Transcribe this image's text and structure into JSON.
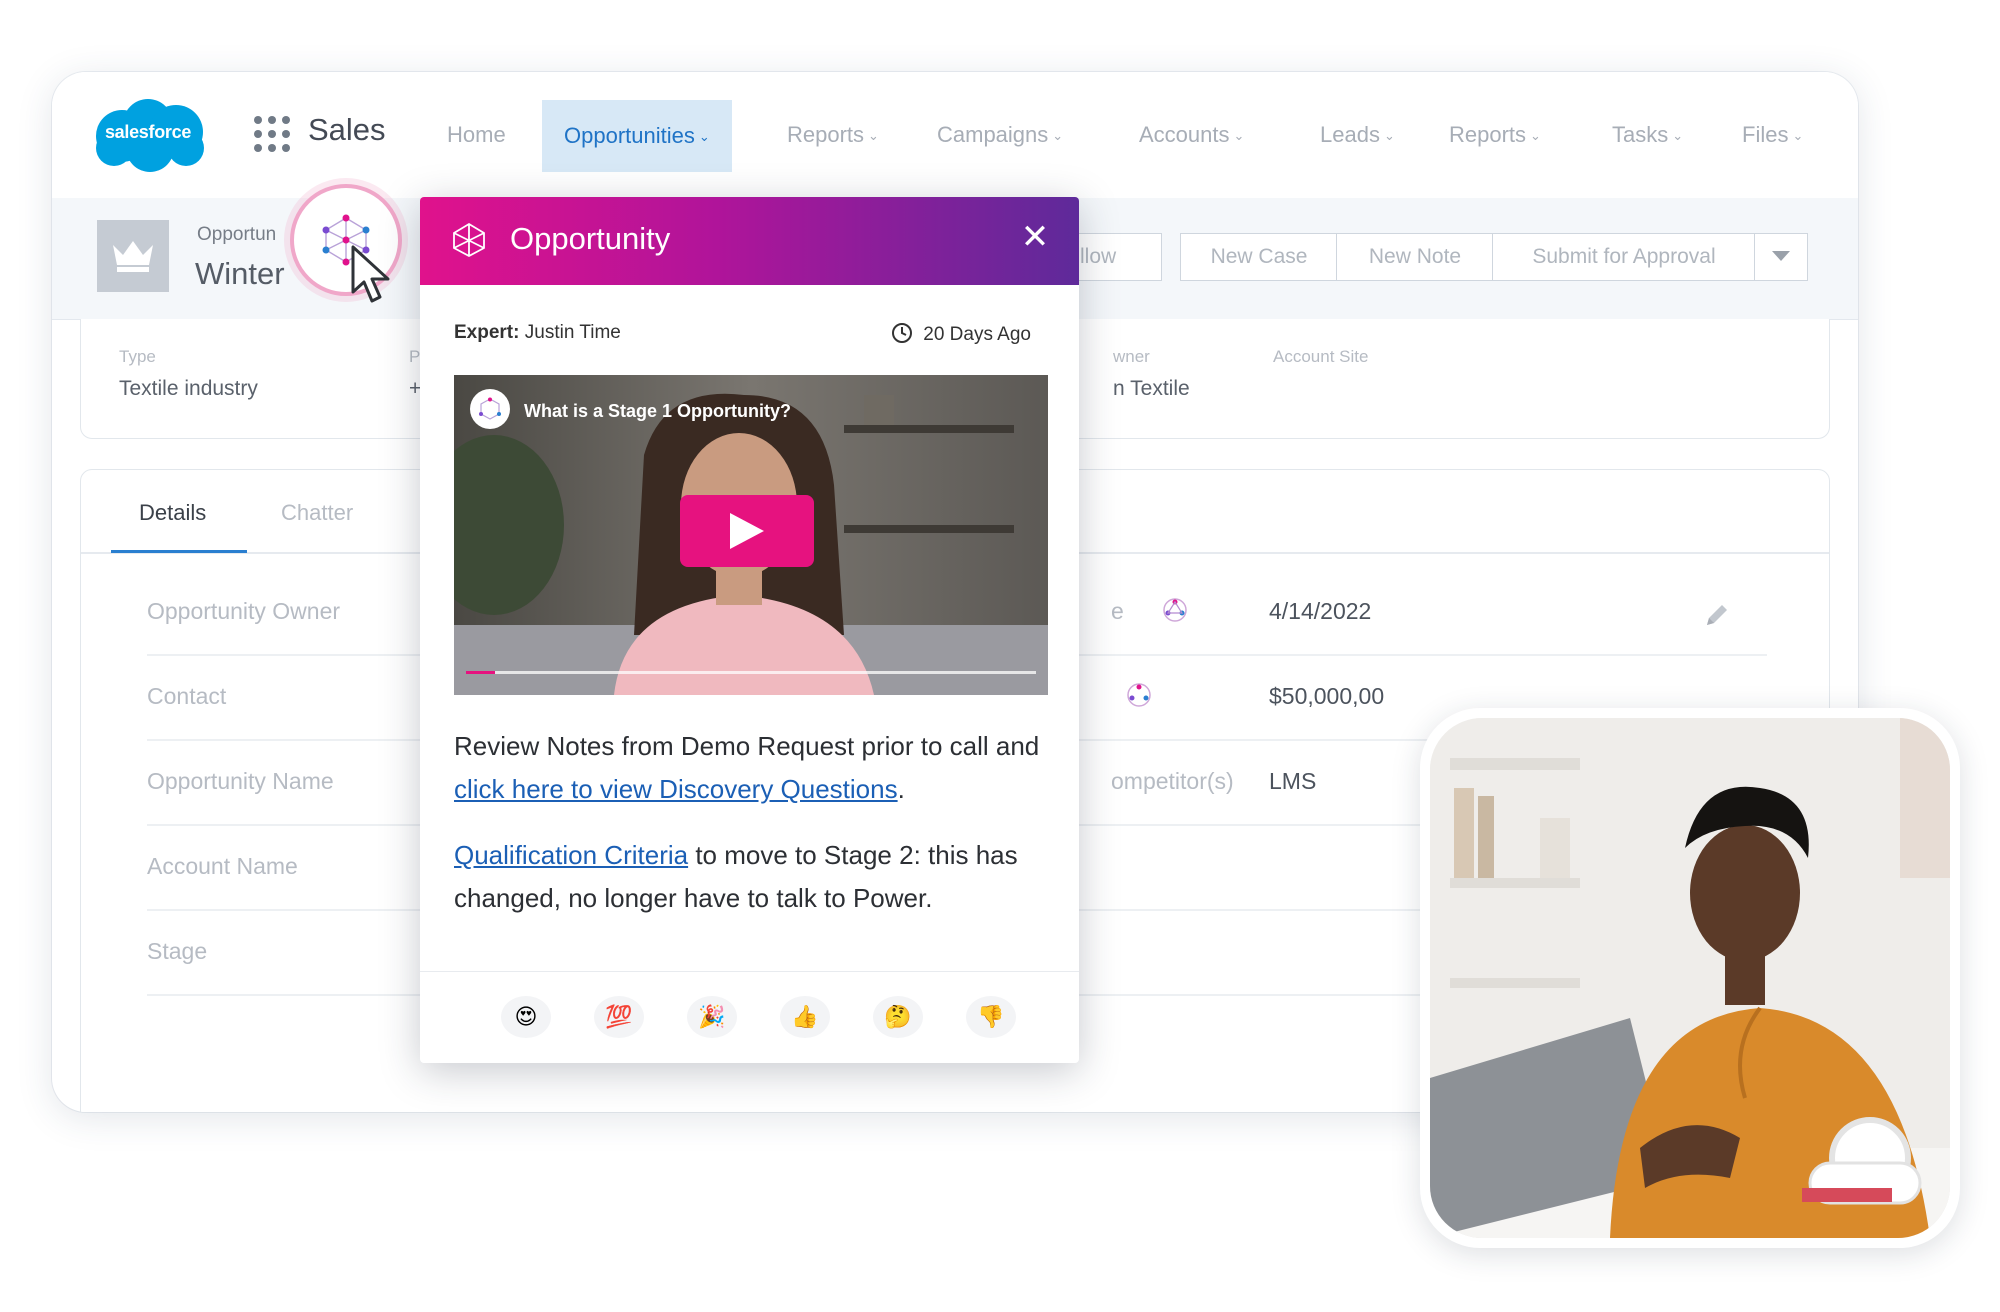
{
  "nav": {
    "logo_text": "salesforce",
    "app_name": "Sales",
    "items": [
      {
        "label": "Home",
        "chevron": ""
      },
      {
        "label": "Opportunities",
        "chevron": "⌄"
      },
      {
        "label": "Reports",
        "chevron": "⌄"
      },
      {
        "label": "Campaigns",
        "chevron": "⌄"
      },
      {
        "label": "Accounts",
        "chevron": "⌄"
      },
      {
        "label": "Leads",
        "chevron": "⌄"
      },
      {
        "label": "Reports",
        "chevron": "⌄"
      },
      {
        "label": "Tasks",
        "chevron": "⌄"
      },
      {
        "label": "Files",
        "chevron": "⌄"
      }
    ]
  },
  "record": {
    "type_label": "Opportun",
    "name": "Winter",
    "buttons": {
      "follow": "llow",
      "new_case": "New Case",
      "new_note": "New Note",
      "submit": "Submit for Approval"
    }
  },
  "highlights": {
    "type_label": "Type",
    "type_value": "Textile industry",
    "p_label": "P",
    "p_value": "+",
    "owner_label": "wner",
    "owner_value": "n Textile",
    "site_label": "Account Site"
  },
  "tabs": {
    "details": "Details",
    "chatter": "Chatter"
  },
  "details": {
    "left_labels": [
      "Opportunity Owner",
      "Contact",
      "Opportunity Name",
      "Account Name",
      "Stage"
    ],
    "right_rows": [
      {
        "label": "e",
        "value": "4/14/2022"
      },
      {
        "label": "",
        "value": "$50,000,00"
      },
      {
        "label": "ompetitor(s)",
        "value": "LMS"
      }
    ]
  },
  "popup": {
    "title": "Opportunity",
    "close": "✕",
    "expert_label": "Expert:",
    "expert_name": "Justin Time",
    "time": "20 Days Ago",
    "video_title": "What is a Stage 1 Opportunity?",
    "video_progress": 0.05,
    "p1_before": "Review Notes from Demo Request prior to call and ",
    "p1_link": "click here to view Discovery Questions",
    "p1_after": ".",
    "p2_link": "Qualification Criteria",
    "p2_after": " to move to Stage 2: this has changed, no longer have to talk to Power.",
    "reactions": [
      "😍",
      "💯",
      "🎉",
      "👍",
      "🤔",
      "👎"
    ]
  },
  "colors": {
    "accent_blue": "#1f73c6",
    "brand_pink": "#e0128c",
    "brand_purple": "#5e2a9a",
    "salesforce_blue": "#00a1e0"
  }
}
